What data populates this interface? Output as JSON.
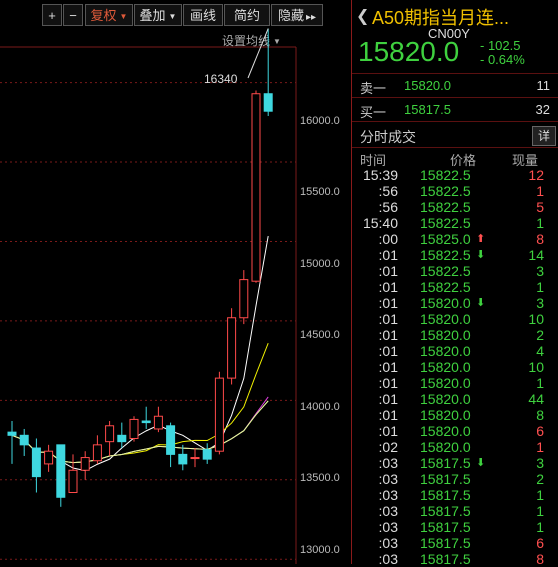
{
  "toolbar": {
    "plus": "+",
    "minus": "−",
    "fuquan": "复权",
    "diejia": "叠加",
    "huaxian": "画线",
    "jianyue": "简约",
    "yincang": "隐藏",
    "more": "▸▸"
  },
  "settings": "设置均线",
  "peak_label": "16340",
  "y_labels": [
    "16000.0",
    "15500.0",
    "15000.0",
    "14500.0",
    "14000.0",
    "13500.0",
    "13000.0"
  ],
  "panel": {
    "title": "A50期指当月连...",
    "code": "CN00Y",
    "price": "15820.0",
    "change": "- 102.5",
    "change_pct": "- 0.64%",
    "sell_label": "卖一",
    "sell_price": "15820.0",
    "sell_vol": "11",
    "buy_label": "买一",
    "buy_price": "15817.5",
    "buy_vol": "32",
    "trades_title": "分时成交",
    "detail_btn": "详",
    "col_time": "时间",
    "col_price": "价格",
    "col_vol": "现量"
  },
  "trades": [
    {
      "time": "15:39",
      "price": "15822.5",
      "arrow": "",
      "vol": "12",
      "dir": "up"
    },
    {
      "time": ":56",
      "price": "15822.5",
      "arrow": "",
      "vol": "1",
      "dir": "up"
    },
    {
      "time": ":56",
      "price": "15822.5",
      "arrow": "",
      "vol": "5",
      "dir": "up"
    },
    {
      "time": "15:40",
      "price": "15822.5",
      "arrow": "",
      "vol": "1",
      "dir": "dn"
    },
    {
      "time": ":00",
      "price": "15825.0",
      "arrow": "up",
      "vol": "8",
      "dir": "up"
    },
    {
      "time": ":01",
      "price": "15822.5",
      "arrow": "dn",
      "vol": "14",
      "dir": "dn"
    },
    {
      "time": ":01",
      "price": "15822.5",
      "arrow": "",
      "vol": "3",
      "dir": "dn"
    },
    {
      "time": ":01",
      "price": "15822.5",
      "arrow": "",
      "vol": "1",
      "dir": "dn"
    },
    {
      "time": ":01",
      "price": "15820.0",
      "arrow": "dn",
      "vol": "3",
      "dir": "dn"
    },
    {
      "time": ":01",
      "price": "15820.0",
      "arrow": "",
      "vol": "10",
      "dir": "dn"
    },
    {
      "time": ":01",
      "price": "15820.0",
      "arrow": "",
      "vol": "2",
      "dir": "dn"
    },
    {
      "time": ":01",
      "price": "15820.0",
      "arrow": "",
      "vol": "4",
      "dir": "dn"
    },
    {
      "time": ":01",
      "price": "15820.0",
      "arrow": "",
      "vol": "10",
      "dir": "dn"
    },
    {
      "time": ":01",
      "price": "15820.0",
      "arrow": "",
      "vol": "1",
      "dir": "dn"
    },
    {
      "time": ":01",
      "price": "15820.0",
      "arrow": "",
      "vol": "44",
      "dir": "dn"
    },
    {
      "time": ":01",
      "price": "15820.0",
      "arrow": "",
      "vol": "8",
      "dir": "dn"
    },
    {
      "time": ":01",
      "price": "15820.0",
      "arrow": "",
      "vol": "6",
      "dir": "up"
    },
    {
      "time": ":02",
      "price": "15820.0",
      "arrow": "",
      "vol": "1",
      "dir": "up"
    },
    {
      "time": ":03",
      "price": "15817.5",
      "arrow": "dn",
      "vol": "3",
      "dir": "dn"
    },
    {
      "time": ":03",
      "price": "15817.5",
      "arrow": "",
      "vol": "2",
      "dir": "dn"
    },
    {
      "time": ":03",
      "price": "15817.5",
      "arrow": "",
      "vol": "1",
      "dir": "dn"
    },
    {
      "time": ":03",
      "price": "15817.5",
      "arrow": "",
      "vol": "1",
      "dir": "dn"
    },
    {
      "time": ":03",
      "price": "15817.5",
      "arrow": "",
      "vol": "1",
      "dir": "dn"
    },
    {
      "time": ":03",
      "price": "15817.5",
      "arrow": "",
      "vol": "6",
      "dir": "up"
    },
    {
      "time": ":03",
      "price": "15817.5",
      "arrow": "",
      "vol": "8",
      "dir": "up"
    }
  ],
  "chart_data": {
    "type": "candlestick",
    "ylim": [
      12970,
      16520
    ],
    "candles": [
      {
        "o": 13800,
        "h": 13870,
        "l": 13600,
        "c": 13780
      },
      {
        "o": 13780,
        "h": 13820,
        "l": 13650,
        "c": 13720
      },
      {
        "o": 13700,
        "h": 13760,
        "l": 13420,
        "c": 13520
      },
      {
        "o": 13600,
        "h": 13720,
        "l": 13550,
        "c": 13680
      },
      {
        "o": 13720,
        "h": 13720,
        "l": 13330,
        "c": 13390
      },
      {
        "o": 13420,
        "h": 13660,
        "l": 13420,
        "c": 13560
      },
      {
        "o": 13560,
        "h": 13680,
        "l": 13500,
        "c": 13640
      },
      {
        "o": 13620,
        "h": 13780,
        "l": 13600,
        "c": 13720
      },
      {
        "o": 13740,
        "h": 13870,
        "l": 13650,
        "c": 13840
      },
      {
        "o": 13780,
        "h": 13860,
        "l": 13700,
        "c": 13740
      },
      {
        "o": 13760,
        "h": 13900,
        "l": 13740,
        "c": 13880
      },
      {
        "o": 13870,
        "h": 13960,
        "l": 13820,
        "c": 13860
      },
      {
        "o": 13820,
        "h": 13960,
        "l": 13800,
        "c": 13900
      },
      {
        "o": 13840,
        "h": 13860,
        "l": 13580,
        "c": 13660
      },
      {
        "o": 13660,
        "h": 13720,
        "l": 13560,
        "c": 13600
      },
      {
        "o": 13640,
        "h": 13700,
        "l": 13580,
        "c": 13640
      },
      {
        "o": 13690,
        "h": 13730,
        "l": 13600,
        "c": 13630
      },
      {
        "o": 13680,
        "h": 14180,
        "l": 13660,
        "c": 14140
      },
      {
        "o": 14140,
        "h": 14580,
        "l": 14100,
        "c": 14520
      },
      {
        "o": 14520,
        "h": 14820,
        "l": 14480,
        "c": 14760
      },
      {
        "o": 14750,
        "h": 15950,
        "l": 14740,
        "c": 15930
      },
      {
        "o": 15930,
        "h": 16340,
        "l": 15790,
        "c": 15820
      }
    ]
  }
}
